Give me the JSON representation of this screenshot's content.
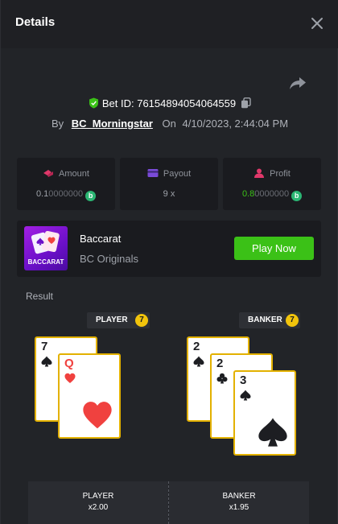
{
  "header": {
    "title": "Details"
  },
  "bet": {
    "id_text": "Bet ID: 76154894054064559",
    "by_label": "By",
    "username": "BC_Morningstar",
    "on_label": "On",
    "datetime": "4/10/2023, 2:44:04 PM"
  },
  "stats": [
    {
      "label": "Amount",
      "value_main": "0.1",
      "value_dim": "0000000",
      "coin": "b",
      "icon": "amount-icon"
    },
    {
      "label": "Payout",
      "value_main": "9 x",
      "icon": "payout-icon"
    },
    {
      "label": "Profit",
      "value_main": "0.8",
      "value_dim": "0000000",
      "coin": "b",
      "icon": "profit-icon"
    }
  ],
  "game": {
    "name": "Baccarat",
    "provider": "BC Originals",
    "thumb_label": "BACCARAT",
    "play_label": "Play Now"
  },
  "result": {
    "label": "Result",
    "player": {
      "label": "PLAYER",
      "score": "7",
      "cards": [
        {
          "rank": "7",
          "suit": "spade"
        },
        {
          "rank": "Q",
          "suit": "heart"
        }
      ]
    },
    "banker": {
      "label": "BANKER",
      "score": "7",
      "cards": [
        {
          "rank": "2",
          "suit": "spade"
        },
        {
          "rank": "2",
          "suit": "club"
        },
        {
          "rank": "3",
          "suit": "spade"
        }
      ]
    }
  },
  "bets": [
    {
      "name": "PLAYER",
      "odds": "x2.00"
    },
    {
      "name": "BANKER",
      "odds": "x1.95"
    }
  ],
  "colors": {
    "accent_green": "#3bc117",
    "gold": "#f2c40c",
    "card_border": "#e3b100",
    "panel": "#222428"
  }
}
